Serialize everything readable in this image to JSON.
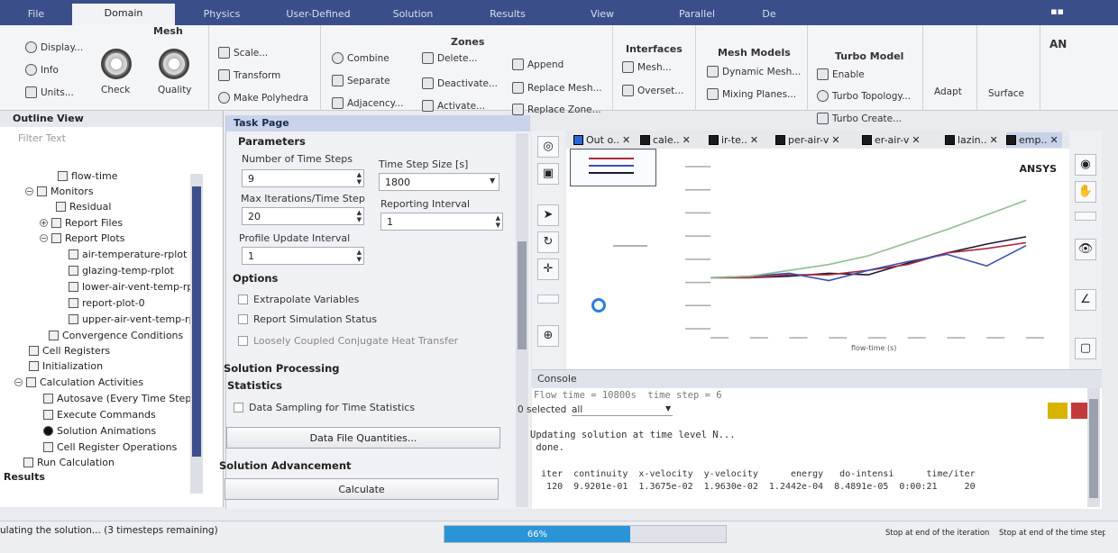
{
  "colors": {
    "accent": "#3a4f8a",
    "progress": "#2b94d6",
    "task_header": "#c9d4ea"
  },
  "ribbon_tabs": [
    "File",
    "Domain",
    "Physics",
    "User-Defined",
    "Solution",
    "Results",
    "View",
    "Parallel",
    "De"
  ],
  "active_tab": "Domain",
  "user": "AN",
  "mesh": {
    "title": "Mesh",
    "display": "Display...",
    "info": "Info",
    "units": "Units...",
    "check": "Check",
    "quality": "Quality",
    "scale": "Scale...",
    "transform": "Transform",
    "make_polyhedra": "Make Polyhedra"
  },
  "zones": {
    "title": "Zones",
    "combine": "Combine",
    "separate": "Separate",
    "adjacency": "Adjacency...",
    "delete": "Delete...",
    "deactivate": "Deactivate...",
    "activate": "Activate...",
    "append": "Append",
    "replace_mesh": "Replace Mesh...",
    "replace_zone": "Replace Zone..."
  },
  "interfaces": {
    "title": "Interfaces",
    "mesh": "Mesh...",
    "overset": "Overset..."
  },
  "mesh_models": {
    "title": "Mesh Models",
    "dynamic": "Dynamic Mesh...",
    "mixing": "Mixing Planes..."
  },
  "turbo": {
    "title": "Turbo Model",
    "enable": "Enable",
    "topology": "Turbo Topology...",
    "create": "Turbo Create..."
  },
  "adapt": "Adapt",
  "surface": "Surface",
  "outline": {
    "title": "Outline View",
    "filter_placeholder": "Filter Text",
    "items": [
      "flow-time",
      "Monitors",
      "Residual",
      "Report Files",
      "Report Plots",
      "air-temperature-rplot",
      "glazing-temp-rplot",
      "lower-air-vent-temp-rpl",
      "report-plot-0",
      "upper-air-vent-temp-rp",
      "Convergence Conditions",
      "Cell Registers",
      "Initialization",
      "Calculation Activities",
      "Autosave (Every Time Step)",
      "Execute Commands",
      "Solution Animations",
      "Cell Register Operations",
      "Run Calculation",
      "Results"
    ]
  },
  "task": {
    "title": "Task Page",
    "parameters": "Parameters",
    "num_steps_label": "Number of Time Steps",
    "num_steps": "9",
    "step_size_label": "Time Step Size [s]",
    "step_size": "1800",
    "max_iter_label": "Max Iterations/Time Step",
    "max_iter": "20",
    "report_interval_label": "Reporting Interval",
    "report_interval": "1",
    "profile_label": "Profile Update Interval",
    "profile": "1",
    "options": "Options",
    "opt_extrapolate": "Extrapolate Variables",
    "opt_report": "Report Simulation Status",
    "opt_loosely": "Loosely Coupled Conjugate Heat Transfer",
    "processing": "Solution Processing",
    "statistics": "Statistics",
    "sampling": "Data Sampling for Time Statistics",
    "data_file": "Data File Quantities...",
    "advancement": "Solution Advancement",
    "calculate": "Calculate"
  },
  "graph_tabs": [
    "Out o..",
    "cale..",
    "ir-te..",
    "per-air-v",
    "er-air-v",
    "lazin..",
    "emp.."
  ],
  "brand": "ANSYS",
  "chart_data": {
    "type": "line",
    "xlabel": "flow-time (s)",
    "series": [
      {
        "color": "#1a1a2e",
        "values": [
          0.35,
          0.35,
          0.36,
          0.38,
          0.37,
          0.45,
          0.52,
          0.58,
          0.63
        ]
      },
      {
        "color": "#b02a3c",
        "values": [
          0.35,
          0.35,
          0.37,
          0.37,
          0.4,
          0.44,
          0.52,
          0.55,
          0.59
        ]
      },
      {
        "color": "#3b4fb0",
        "values": [
          0.35,
          0.36,
          0.38,
          0.33,
          0.4,
          0.46,
          0.51,
          0.43,
          0.57
        ]
      },
      {
        "color": "#8fbf8f",
        "values": [
          0.35,
          0.36,
          0.4,
          0.44,
          0.5,
          0.59,
          0.68,
          0.78,
          0.88
        ]
      }
    ]
  },
  "console": {
    "title": "Console",
    "flow_line": "Flow time = 10800s  time step = 6",
    "selected": "0 selected",
    "filter": "all",
    "line1": "Updating solution at time level N...",
    "line2": " done.",
    "headers": "  iter  continuity  x-velocity  y-velocity      energy   do-intensi      time/iter",
    "row": "   120  9.9201e-01  1.3675e-02  1.9630e-02  1.2442e-04  8.4891e-05  0:00:21     20"
  },
  "status": {
    "text": "ulating the solution... (3 timesteps remaining)",
    "progress": "66%",
    "progress_value": 0.66,
    "stop_iter": "Stop at end of the iteration",
    "stop_step": "Stop at end of the time step"
  }
}
